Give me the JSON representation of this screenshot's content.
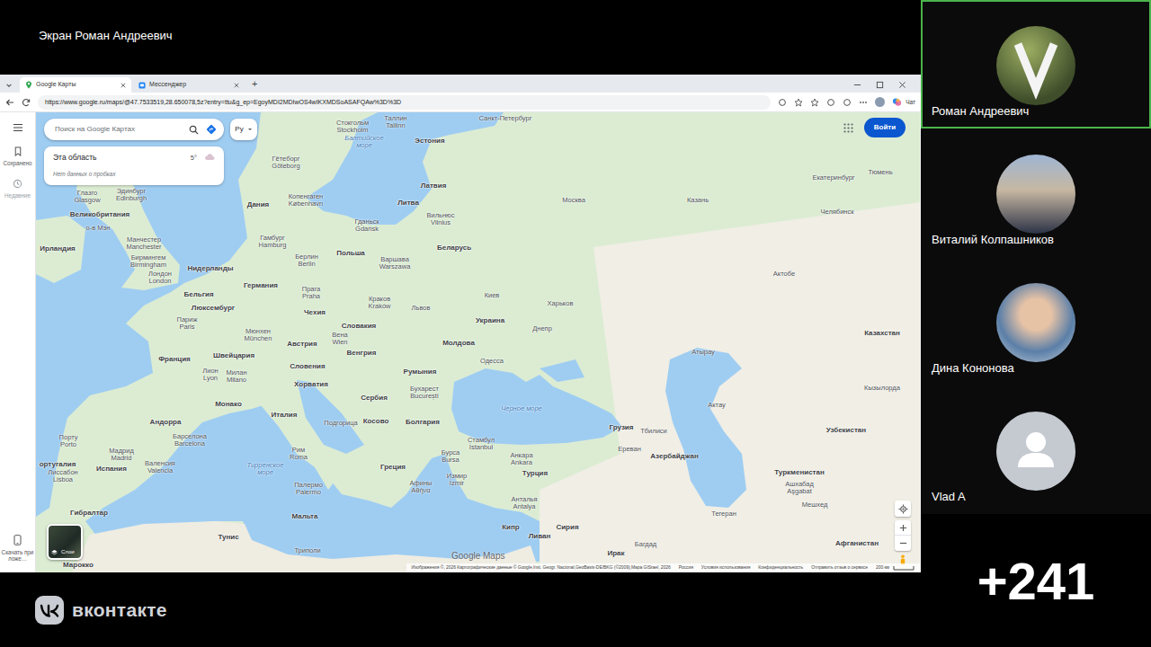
{
  "call": {
    "screen_title": "Экран Роман Андреевич",
    "logo": "вконтакте",
    "more_count": "+241"
  },
  "participants": [
    {
      "name": "Роман Андреевич",
      "selected": true,
      "kind": "photo"
    },
    {
      "name": "Виталий Колпашников",
      "selected": false,
      "kind": "photo"
    },
    {
      "name": "Дина Кононова",
      "selected": false,
      "kind": "photo"
    },
    {
      "name": "Vlad A",
      "selected": false,
      "kind": "placeholder"
    }
  ],
  "browser": {
    "tabs": [
      {
        "label": "Google Карты",
        "selected": true
      },
      {
        "label": "Мессенджер",
        "selected": false
      }
    ],
    "new_tab": "+",
    "url": "https://www.google.ru/maps/@47.7533519,28.650078,5z?entry=ttu&g_ep=EgoyMDI2MDIwOS4wIKXMDSoASAFQAw%3D%3D",
    "chat": "Чат"
  },
  "maps": {
    "sidebar": [
      {
        "label": "Сохранено",
        "disabled": false
      },
      {
        "label": "Недавние",
        "disabled": true
      }
    ],
    "download": "Скачать приложе…",
    "search_placeholder": "Поиск на Google Картах",
    "lang": "Ру",
    "area_card": {
      "title": "Эта область",
      "temp": "5°",
      "traffic": "Нет данных о пробках"
    },
    "sign_in": "Войти",
    "layers": "Слои",
    "watermark": "Google Maps",
    "attribution": [
      "Изображения ©, 2026 Картографические данные © Google,Inst. Geogr. Nacional,GeoBasis-DE/BKG (©2009),Mapa GISrael, 2026",
      "Россия",
      "Условия использования",
      "Конфиденциальность",
      "Отправить отзыв о сервисе"
    ],
    "scale": "200 км"
  },
  "map": {
    "labels": [
      {
        "name": "Санкт-Петербург",
        "kind": "city"
      },
      {
        "name": "Таллин",
        "sub": "Tallinn",
        "kind": "city"
      },
      {
        "name": "Стокгольм",
        "sub": "Stockholm",
        "kind": "city"
      },
      {
        "name": "Эстония",
        "kind": "country"
      },
      {
        "name": "Балтийское море",
        "kind": "sea"
      },
      {
        "name": "Гётеборг",
        "sub": "Göteborg",
        "kind": "city"
      },
      {
        "name": "Латвия",
        "kind": "country"
      },
      {
        "name": "Москва",
        "kind": "city"
      },
      {
        "name": "Казань",
        "kind": "city"
      },
      {
        "name": "Екатеринбург",
        "kind": "city"
      },
      {
        "name": "Тюмень",
        "kind": "city"
      },
      {
        "name": "Челябинск",
        "kind": "city"
      },
      {
        "name": "Дания",
        "kind": "country"
      },
      {
        "name": "Копенгаген",
        "sub": "København",
        "kind": "city"
      },
      {
        "name": "Литва",
        "kind": "country"
      },
      {
        "name": "Вильнюс",
        "sub": "Vilnius",
        "kind": "city"
      },
      {
        "name": "Эдинбург",
        "sub": "Edinburgh",
        "kind": "city"
      },
      {
        "name": "Глазго",
        "sub": "Glasgow",
        "kind": "city"
      },
      {
        "name": "Великобритания",
        "kind": "country"
      },
      {
        "name": "о-в Мэн",
        "kind": "city"
      },
      {
        "name": "Ирландия",
        "kind": "country"
      },
      {
        "name": "Манчестер",
        "sub": "Manchester",
        "kind": "city"
      },
      {
        "name": "Бирмингем",
        "sub": "Birmingham",
        "kind": "city"
      },
      {
        "name": "Лондон",
        "sub": "London",
        "kind": "city"
      },
      {
        "name": "Нидерланды",
        "kind": "country"
      },
      {
        "name": "Гамбург",
        "sub": "Hamburg",
        "kind": "city"
      },
      {
        "name": "Берлин",
        "sub": "Berlin",
        "kind": "city"
      },
      {
        "name": "Гданьск",
        "sub": "Gdańsk",
        "kind": "city"
      },
      {
        "name": "Беларусь",
        "kind": "country"
      },
      {
        "name": "Польша",
        "kind": "country"
      },
      {
        "name": "Варшава",
        "sub": "Warszawa",
        "kind": "city"
      },
      {
        "name": "Германия",
        "kind": "country"
      },
      {
        "name": "Бельгия",
        "kind": "country"
      },
      {
        "name": "Люксембург",
        "kind": "country"
      },
      {
        "name": "Париж",
        "sub": "Paris",
        "kind": "city"
      },
      {
        "name": "Прага",
        "sub": "Praha",
        "kind": "city"
      },
      {
        "name": "Краков",
        "sub": "Kraków",
        "kind": "city"
      },
      {
        "name": "Львов",
        "kind": "city"
      },
      {
        "name": "Киев",
        "kind": "city"
      },
      {
        "name": "Харьков",
        "kind": "city"
      },
      {
        "name": "Чехия",
        "kind": "country"
      },
      {
        "name": "Украина",
        "kind": "country"
      },
      {
        "name": "Словакия",
        "kind": "country"
      },
      {
        "name": "Днепр",
        "kind": "city"
      },
      {
        "name": "Мюнхен",
        "sub": "München",
        "kind": "city"
      },
      {
        "name": "Вена",
        "sub": "Wien",
        "kind": "city"
      },
      {
        "name": "Австрия",
        "kind": "country"
      },
      {
        "name": "Молдова",
        "kind": "country"
      },
      {
        "name": "Венгрия",
        "kind": "country"
      },
      {
        "name": "Швейцария",
        "kind": "country"
      },
      {
        "name": "Франция",
        "kind": "country"
      },
      {
        "name": "Одесса",
        "kind": "city"
      },
      {
        "name": "Словения",
        "kind": "country"
      },
      {
        "name": "Румыния",
        "kind": "country"
      },
      {
        "name": "Лион",
        "sub": "Lyon",
        "kind": "city"
      },
      {
        "name": "Милан",
        "sub": "Milano",
        "kind": "city"
      },
      {
        "name": "Хорватия",
        "kind": "country"
      },
      {
        "name": "Бухарест",
        "sub": "București",
        "kind": "city"
      },
      {
        "name": "Сербия",
        "kind": "country"
      },
      {
        "name": "Монако",
        "kind": "country"
      },
      {
        "name": "Черное море",
        "kind": "sea"
      },
      {
        "name": "Италия",
        "kind": "country"
      },
      {
        "name": "Косово",
        "kind": "country"
      },
      {
        "name": "Подгорица",
        "kind": "city"
      },
      {
        "name": "Болгария",
        "kind": "country"
      },
      {
        "name": "Андорра",
        "kind": "country"
      },
      {
        "name": "Грузия",
        "kind": "country"
      },
      {
        "name": "Тбилиси",
        "kind": "city"
      },
      {
        "name": "Барселона",
        "sub": "Barcelona",
        "kind": "city"
      },
      {
        "name": "Порту",
        "sub": "Porto",
        "kind": "city"
      },
      {
        "name": "Стамбул",
        "sub": "İstanbul",
        "kind": "city"
      },
      {
        "name": "Ереван",
        "kind": "city"
      },
      {
        "name": "Азербайджан",
        "kind": "country"
      },
      {
        "name": "Мадрид",
        "sub": "Madrid",
        "kind": "city"
      },
      {
        "name": "Рим",
        "sub": "Roma",
        "kind": "city"
      },
      {
        "name": "Бурса",
        "sub": "Bursa",
        "kind": "city"
      },
      {
        "name": "Анкара",
        "sub": "Ankara",
        "kind": "city"
      },
      {
        "name": "ортугалия",
        "kind": "country"
      },
      {
        "name": "Испания",
        "kind": "country"
      },
      {
        "name": "Валенсия",
        "sub": "Valencia",
        "kind": "city"
      },
      {
        "name": "Тирренское море",
        "kind": "sea"
      },
      {
        "name": "Греция",
        "kind": "country"
      },
      {
        "name": "Туркменистан",
        "kind": "country"
      },
      {
        "name": "Турция",
        "kind": "country"
      },
      {
        "name": "Лиссабон",
        "sub": "Lisboa",
        "kind": "city"
      },
      {
        "name": "Измир",
        "sub": "İzmir",
        "kind": "city"
      },
      {
        "name": "Афины",
        "sub": "Αθήνα",
        "kind": "city"
      },
      {
        "name": "Ашхабад",
        "sub": "Aşgabat",
        "kind": "city"
      },
      {
        "name": "Палермо",
        "sub": "Palermo",
        "kind": "city"
      },
      {
        "name": "Анталья",
        "sub": "Antalya",
        "kind": "city"
      },
      {
        "name": "Мешхед",
        "kind": "city"
      },
      {
        "name": "Гибралтар",
        "kind": "country"
      },
      {
        "name": "Тегеран",
        "kind": "city"
      },
      {
        "name": "Мальта",
        "kind": "country"
      },
      {
        "name": "Кипр",
        "kind": "country"
      },
      {
        "name": "Сирия",
        "kind": "country"
      },
      {
        "name": "Ливан",
        "kind": "country"
      },
      {
        "name": "Тунис",
        "kind": "country"
      },
      {
        "name": "Багдад",
        "kind": "city"
      },
      {
        "name": "Афганистан",
        "kind": "country"
      },
      {
        "name": "Триполи",
        "kind": "city"
      },
      {
        "name": "Ирак",
        "kind": "country"
      },
      {
        "name": "Марокко",
        "kind": "country"
      },
      {
        "name": "Узбекистан",
        "kind": "country"
      },
      {
        "name": "Казахстан",
        "kind": "country"
      },
      {
        "name": "Актобе",
        "kind": "city"
      },
      {
        "name": "Атырау",
        "kind": "city"
      },
      {
        "name": "Актау",
        "kind": "city"
      },
      {
        "name": "Кызылорда",
        "kind": "city"
      }
    ]
  }
}
